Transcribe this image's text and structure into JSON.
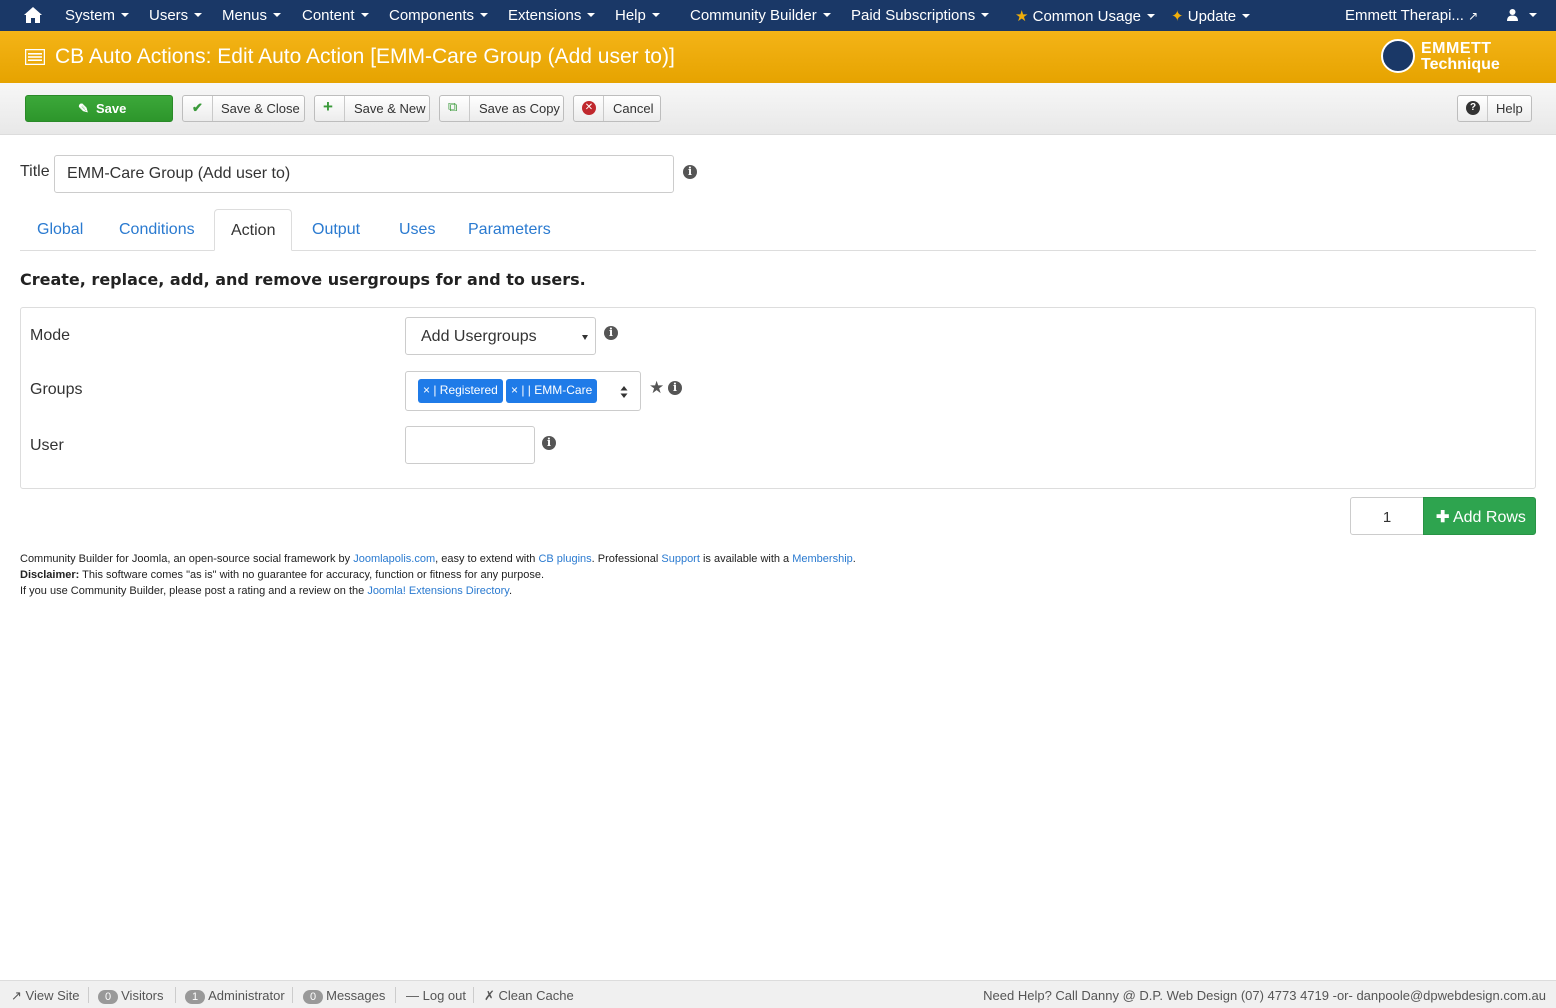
{
  "topnav": {
    "items": [
      "System",
      "Users",
      "Menus",
      "Content",
      "Components",
      "Extensions",
      "Help",
      "Community Builder",
      "Paid Subscriptions",
      "Common Usage",
      "Update"
    ],
    "site_name": "Emmett Therapi...",
    "home_icon": "home-icon",
    "user_icon": "user-icon"
  },
  "header": {
    "title": "CB Auto Actions: Edit Auto Action [EMM-Care Group (Add user to)]",
    "logo_line1": "EMMETT",
    "logo_line2": "Technique",
    "color": "#f0ae0b"
  },
  "toolbar": {
    "save": "Save",
    "save_close": "Save & Close",
    "save_new": "Save & New",
    "save_copy": "Save as Copy",
    "cancel": "Cancel",
    "help": "Help"
  },
  "form": {
    "title_label": "Title",
    "title_value": "EMM-Care Group (Add user to)",
    "tabs": [
      "Global",
      "Conditions",
      "Action",
      "Output",
      "Uses",
      "Parameters"
    ],
    "active_tab": "Action",
    "description": "Create, replace, add, and remove usergroups for and to users.",
    "mode_label": "Mode",
    "mode_value": "Add Usergroups",
    "groups_label": "Groups",
    "groups": [
      "× | Registered",
      "× | | EMM-Care"
    ],
    "user_label": "User",
    "user_value": "",
    "rows_value": "1",
    "add_rows": "Add Rows"
  },
  "footer": {
    "line1_a": "Community Builder for Joomla, an open-source social framework by ",
    "link_joomlapolis": "Joomlapolis.com",
    "line1_b": ", easy to extend with ",
    "link_plugins": "CB plugins",
    "line1_c": ". Professional ",
    "link_support": "Support",
    "line1_d": " is available with a ",
    "link_membership": "Membership",
    "line1_e": ".",
    "disclaimer_label": "Disclaimer:",
    "disclaimer_text": " This software comes \"as is\" with no guarantee for accuracy, function or fitness for any purpose.",
    "line3_a": "If you use Community Builder, please post a rating and a review on the ",
    "link_jed": "Joomla! Extensions Directory",
    "line3_b": "."
  },
  "statusbar": {
    "view_site": "View Site",
    "visitors_count": "0",
    "visitors": "Visitors",
    "admin_count": "1",
    "admin": "Administrator",
    "messages_count": "0",
    "messages": "Messages",
    "logout": "Log out",
    "clean_cache": "Clean Cache",
    "help_text": "Need Help? Call Danny @ D.P. Web Design (07) 4773 4719 -or- danpoole@dpwebdesign.com.au"
  }
}
